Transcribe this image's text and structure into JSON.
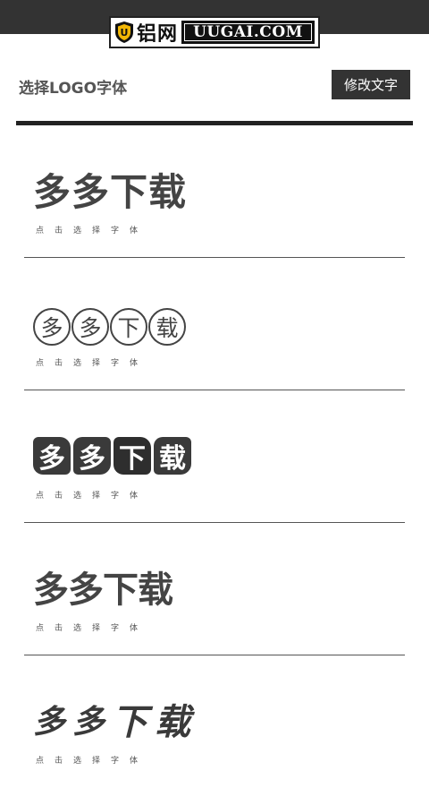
{
  "logo": {
    "cn_text": "铝网",
    "en_text": "UUGAI.COM",
    "icon": "shield-icon"
  },
  "header": {
    "title": "选择LOGO字体",
    "edit_button": "修改文字"
  },
  "fonts": [
    {
      "sample": "多多下载",
      "hint": "点击选择字体"
    },
    {
      "sample": "多多下载",
      "hint": "点击选择字体",
      "chars": [
        "多",
        "多",
        "下",
        "载"
      ]
    },
    {
      "sample": "多多下载",
      "hint": "点击选择字体",
      "chars": [
        "多",
        "多",
        "下",
        "载"
      ]
    },
    {
      "sample": "多多下载",
      "hint": "点击选择字体"
    },
    {
      "sample": "多多下载",
      "hint": "点击选择字体",
      "chars": [
        "多",
        "多",
        "下",
        "载"
      ]
    }
  ],
  "colors": {
    "topbar": "#333333",
    "button": "#333333",
    "accent_rule": "#222222"
  }
}
